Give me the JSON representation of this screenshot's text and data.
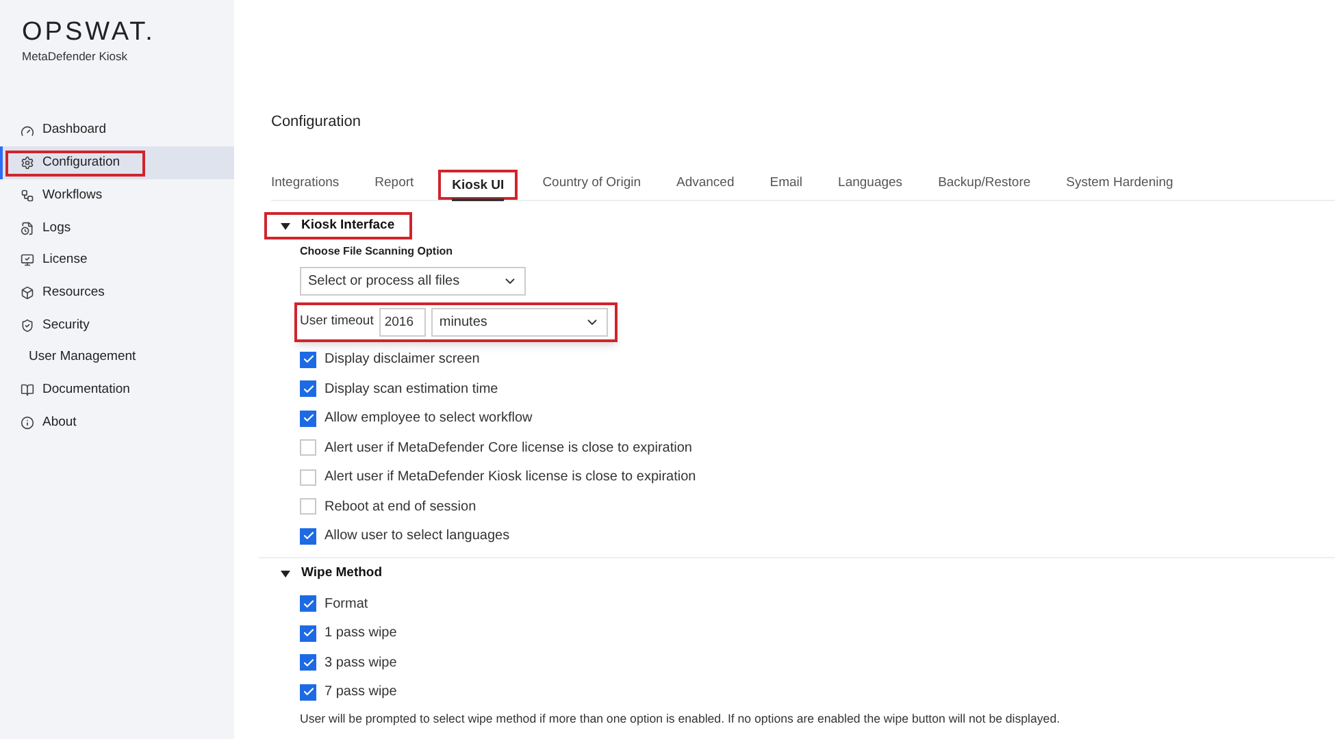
{
  "brand": {
    "logo": "OPSWAT.",
    "product": "MetaDefender Kiosk"
  },
  "sidebar": {
    "items": [
      {
        "label": "Dashboard",
        "selected": false,
        "highlighted": false
      },
      {
        "label": "Configuration",
        "selected": true,
        "highlighted": true
      },
      {
        "label": "Workflows",
        "selected": false,
        "highlighted": false
      },
      {
        "label": "Logs",
        "selected": false,
        "highlighted": false
      },
      {
        "label": "License",
        "selected": false,
        "highlighted": false
      },
      {
        "label": "Resources",
        "selected": false,
        "highlighted": false
      },
      {
        "label": "Security",
        "selected": false,
        "highlighted": false
      },
      {
        "label": "User Management",
        "selected": false,
        "highlighted": false
      },
      {
        "label": "Documentation",
        "selected": false,
        "highlighted": false
      },
      {
        "label": "About",
        "selected": false,
        "highlighted": false
      }
    ]
  },
  "page_title": "Configuration",
  "tabs": [
    {
      "label": "Integrations",
      "selected": false,
      "highlighted": false
    },
    {
      "label": "Report",
      "selected": false,
      "highlighted": false
    },
    {
      "label": "Kiosk UI",
      "selected": true,
      "highlighted": true
    },
    {
      "label": "Country of Origin",
      "selected": false,
      "highlighted": false
    },
    {
      "label": "Advanced",
      "selected": false,
      "highlighted": false
    },
    {
      "label": "Email",
      "selected": false,
      "highlighted": false
    },
    {
      "label": "Languages",
      "selected": false,
      "highlighted": false
    },
    {
      "label": "Backup/Restore",
      "selected": false,
      "highlighted": false
    },
    {
      "label": "System Hardening",
      "selected": false,
      "highlighted": false
    }
  ],
  "kiosk_interface": {
    "title": "Kiosk Interface",
    "expanded": true,
    "highlighted": true,
    "scan_option_label": "Choose File Scanning Option",
    "scan_option_value": "Select or process all files",
    "timeout": {
      "label": "User timeout",
      "value": "2016",
      "unit": "minutes",
      "highlighted": true
    },
    "options": [
      {
        "label": "Display disclaimer screen",
        "checked": true
      },
      {
        "label": "Display scan estimation time",
        "checked": true
      },
      {
        "label": "Allow employee to select workflow",
        "checked": true
      },
      {
        "label": "Alert user if MetaDefender Core license is close to expiration",
        "checked": false
      },
      {
        "label": "Alert user if MetaDefender Kiosk license is close to expiration",
        "checked": false
      },
      {
        "label": "Reboot at end of session",
        "checked": false
      },
      {
        "label": "Allow user to select languages",
        "checked": true
      }
    ]
  },
  "wipe_method": {
    "title": "Wipe Method",
    "expanded": true,
    "options": [
      {
        "label": "Format",
        "checked": true
      },
      {
        "label": "1 pass wipe",
        "checked": true
      },
      {
        "label": "3 pass wipe",
        "checked": true
      },
      {
        "label": "7 pass wipe",
        "checked": true
      }
    ],
    "note": "User will be prompted to select wipe method if more than one option is enabled. If no options are enabled the wipe button will not be displayed."
  }
}
